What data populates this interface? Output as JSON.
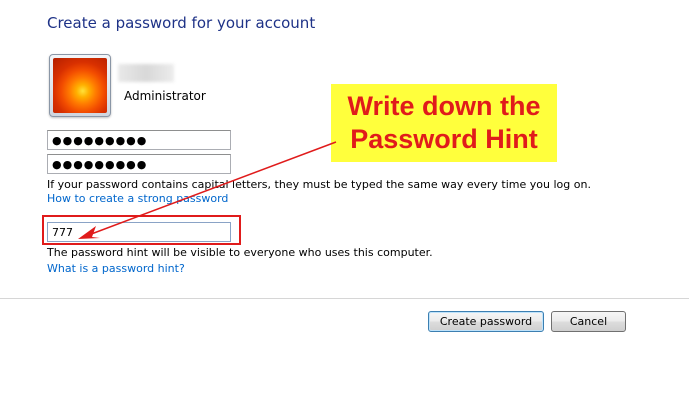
{
  "page": {
    "heading": "Create a password for your account"
  },
  "account": {
    "username": "Administrator",
    "picture_icon": "flower-icon"
  },
  "form": {
    "new_password_value": "●●●●●●●●●",
    "confirm_password_value": "●●●●●●●●●",
    "capital_letters_note": "If your password contains capital letters, they must be typed the same way every time you log on.",
    "strong_password_link": "How to create a strong password",
    "hint_value": "777",
    "hint_visibility_note": "The password hint will be visible to everyone who uses this computer.",
    "hint_help_link": "What is a password hint?"
  },
  "annotation": {
    "line1": "Write down the",
    "line2": "Password Hint",
    "highlight_color": "#e01b1b",
    "callout_background": "#ffff3c"
  },
  "buttons": {
    "create": "Create password",
    "cancel": "Cancel"
  }
}
